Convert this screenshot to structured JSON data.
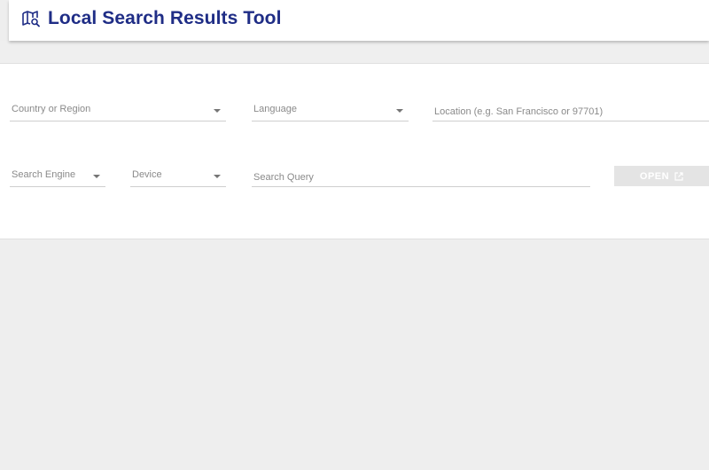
{
  "app": {
    "title": "Local Search Results Tool",
    "logo_icon": "map-search-icon",
    "accent_color": "#1f2d86"
  },
  "form": {
    "country": {
      "label": "Country or Region",
      "icon": "dropdown-caret-icon"
    },
    "language": {
      "label": "Language",
      "icon": "dropdown-caret-icon"
    },
    "location": {
      "placeholder": "Location (e.g. San Francisco or 97701)"
    },
    "search_engine": {
      "label": "Search Engine",
      "icon": "dropdown-caret-icon"
    },
    "device": {
      "label": "Device",
      "icon": "dropdown-caret-icon"
    },
    "query": {
      "placeholder": "Search Query"
    },
    "open_button": {
      "label": "OPEN",
      "icon": "open-in-new-icon",
      "disabled": true
    }
  }
}
